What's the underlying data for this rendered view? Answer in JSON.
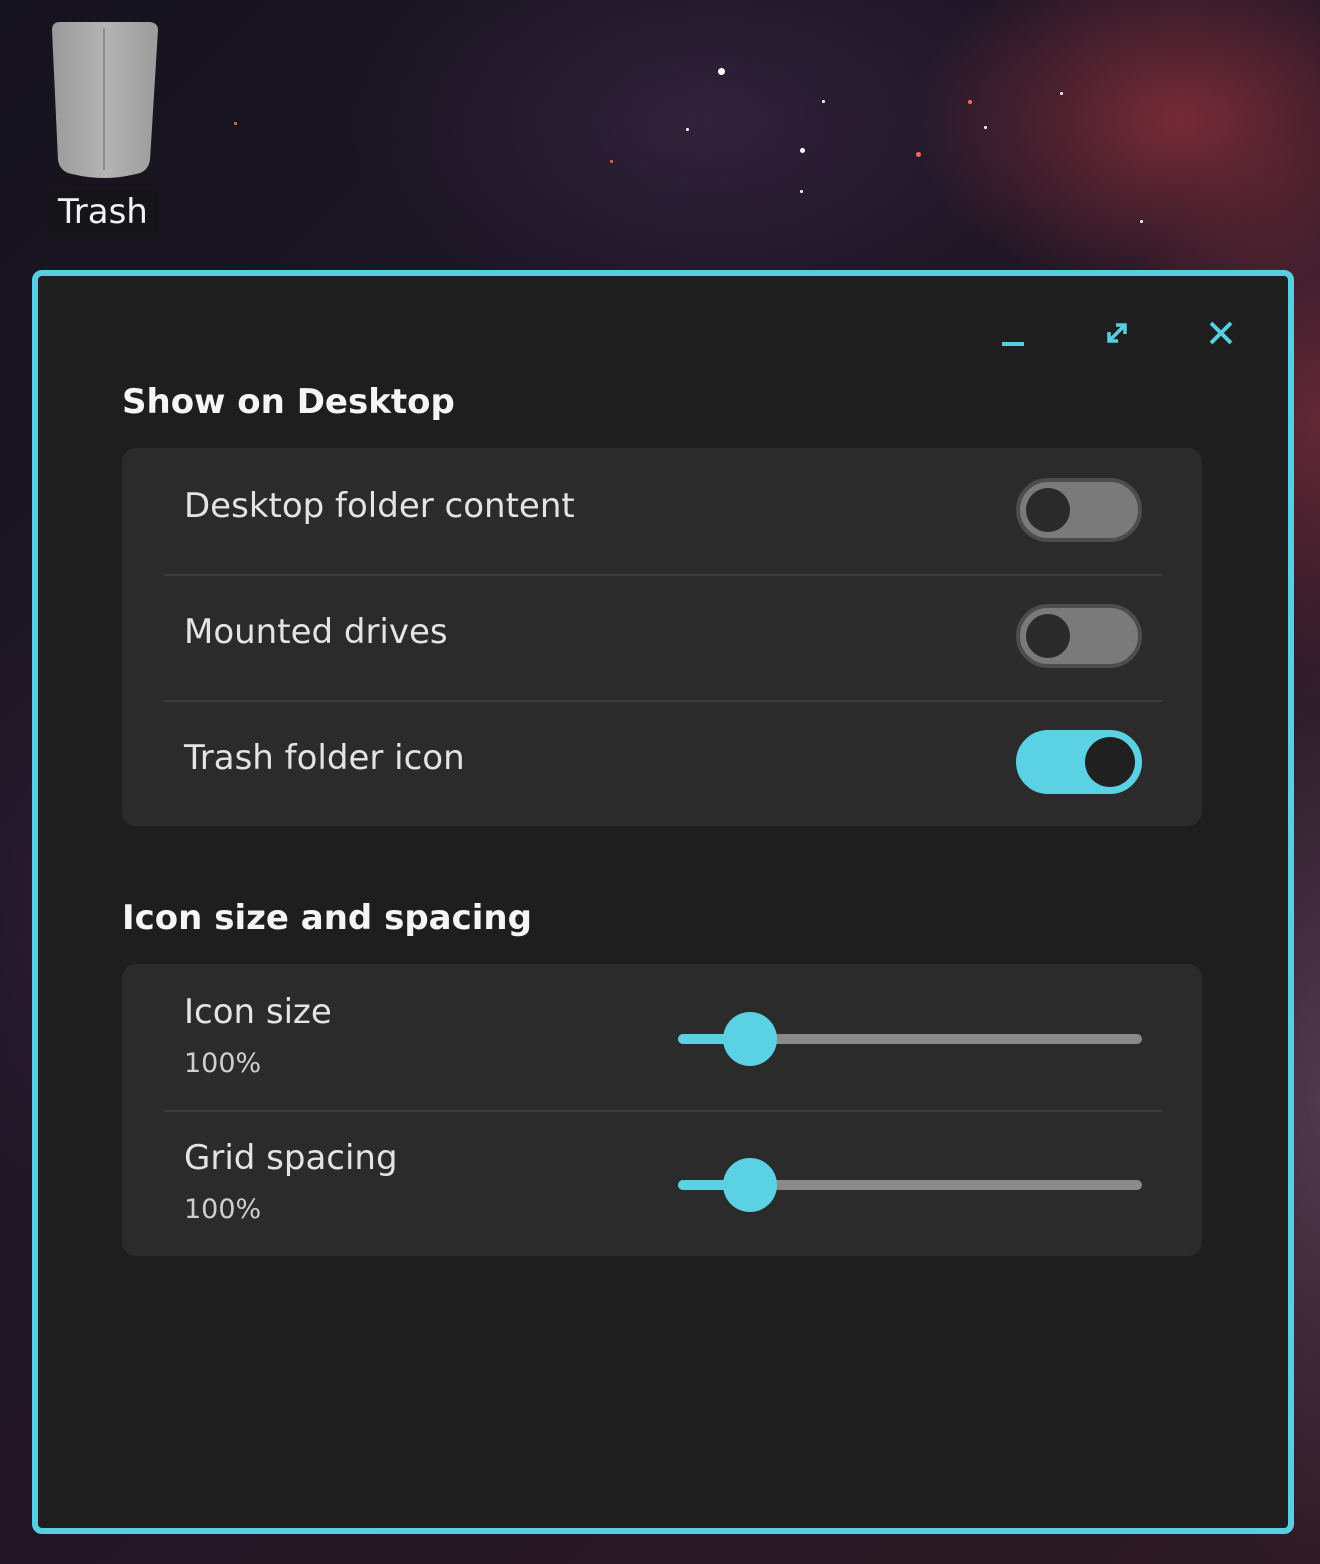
{
  "desktop": {
    "trash_label": "Trash",
    "trash_icon": "trash-bin-icon"
  },
  "window": {
    "accent_color": "#56cfe1",
    "controls": {
      "minimize_icon": "minimize-icon",
      "maximize_icon": "maximize-icon",
      "close_icon": "close-icon"
    },
    "show_on_desktop": {
      "title": "Show on Desktop",
      "items": [
        {
          "label": "Desktop folder content",
          "enabled": false
        },
        {
          "label": "Mounted drives",
          "enabled": false
        },
        {
          "label": "Trash folder icon",
          "enabled": true
        }
      ]
    },
    "icon_size_spacing": {
      "title": "Icon size and spacing",
      "sliders": [
        {
          "label": "Icon size",
          "value_text": "100%",
          "position": 0.155
        },
        {
          "label": "Grid spacing",
          "value_text": "100%",
          "position": 0.155
        }
      ]
    }
  }
}
